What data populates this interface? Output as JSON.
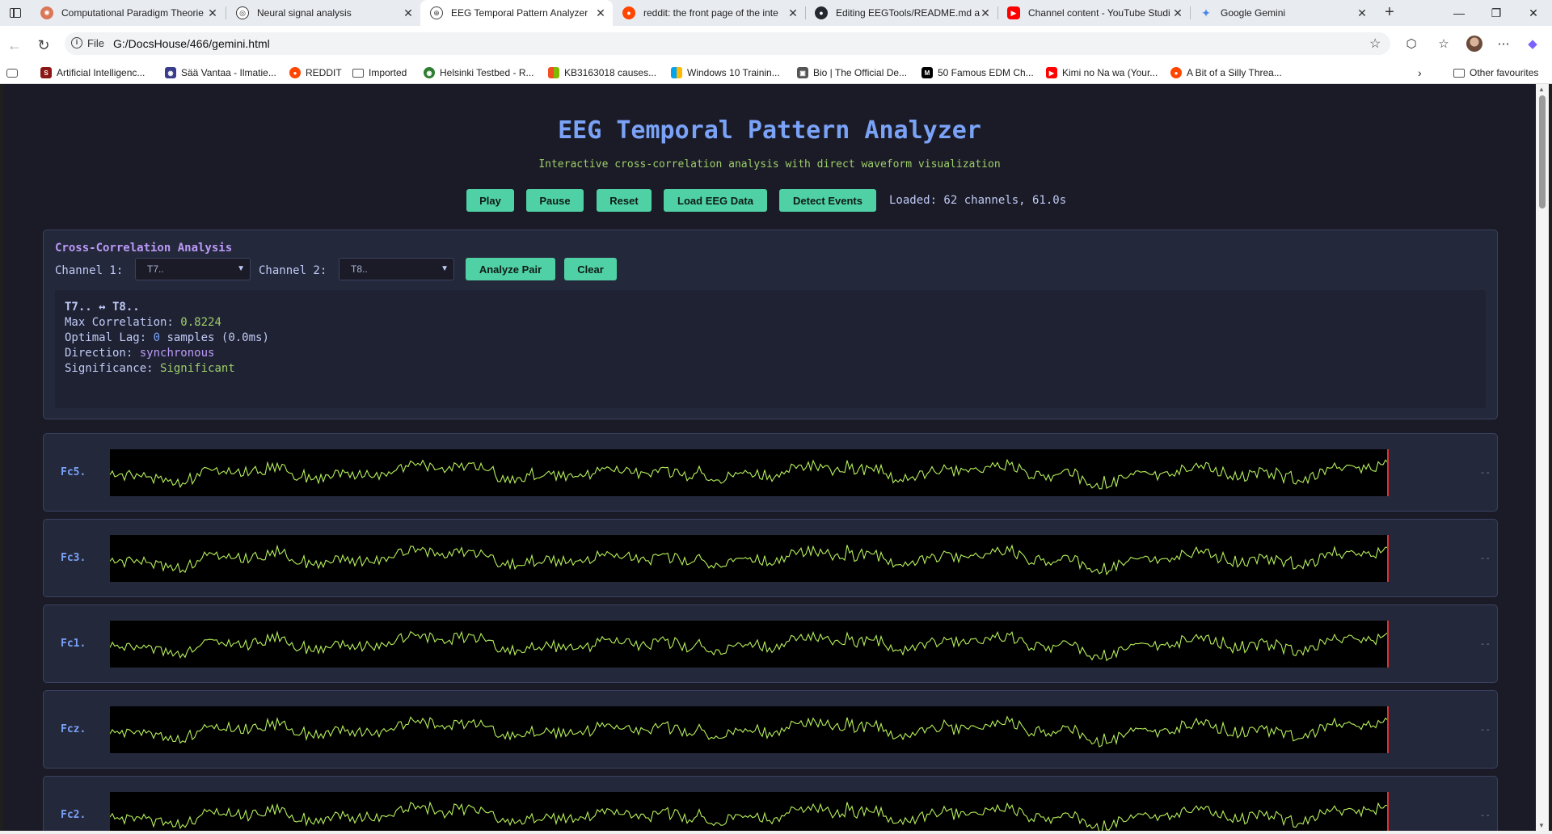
{
  "browser": {
    "tabs": [
      {
        "title": "Computational Paradigm Theorie",
        "icon": "claude-icon",
        "active": false
      },
      {
        "title": "Neural signal analysis",
        "icon": "chatgpt-icon",
        "active": false
      },
      {
        "title": "EEG Temporal Pattern Analyzer",
        "icon": "globe-icon",
        "active": true
      },
      {
        "title": "reddit: the front page of the inte",
        "icon": "reddit-icon",
        "active": false
      },
      {
        "title": "Editing EEGTools/README.md at",
        "icon": "github-icon",
        "active": false
      },
      {
        "title": "Channel content - YouTube Studi",
        "icon": "youtube-icon",
        "active": false
      },
      {
        "title": "Google Gemini",
        "icon": "gemini-icon",
        "active": false
      }
    ],
    "address": {
      "scheme_label": "File",
      "url": "G:/DocsHouse/466/gemini.html"
    },
    "bookmarks": [
      {
        "label": "Artificial Intelligenc...",
        "icon": "stanford-icon"
      },
      {
        "label": "Sää Vantaa - Ilmatie...",
        "icon": "fmi-icon"
      },
      {
        "label": "REDDIT",
        "icon": "reddit-icon"
      },
      {
        "label": "Imported",
        "icon": "folder-icon"
      },
      {
        "label": "Helsinki Testbed - R...",
        "icon": "globe-icon"
      },
      {
        "label": "KB3163018 causes...",
        "icon": "microsoft-icon"
      },
      {
        "label": "Windows 10 Trainin...",
        "icon": "microsoft-icon"
      },
      {
        "label": "Bio | The Official De...",
        "icon": "site-icon"
      },
      {
        "label": "50 Famous EDM Ch...",
        "icon": "medium-icon"
      },
      {
        "label": "Kimi no Na wa (Your...",
        "icon": "youtube-icon"
      },
      {
        "label": "A Bit of a Silly Threa...",
        "icon": "reddit-icon"
      }
    ],
    "other_favourites": "Other favourites"
  },
  "app": {
    "title": "EEG Temporal Pattern Analyzer",
    "subtitle": "Interactive cross-correlation analysis with direct waveform visualization",
    "controls": {
      "play": "Play",
      "pause": "Pause",
      "reset": "Reset",
      "load": "Load EEG Data",
      "detect": "Detect Events"
    },
    "loaded_status": "Loaded: 62 channels, 61.0s",
    "xcorr": {
      "title": "Cross-Correlation Analysis",
      "channel1_label": "Channel 1:",
      "channel1_value": "T7..",
      "channel2_label": "Channel 2:",
      "channel2_value": "T8..",
      "analyze": "Analyze Pair",
      "clear": "Clear",
      "result": {
        "pair": "T7.. ↔ T8..",
        "max_corr_label": "Max Correlation:",
        "max_corr_value": "0.8224",
        "lag_label": "Optimal Lag:",
        "lag_value": "0",
        "lag_unit": "samples (0.0ms)",
        "direction_label": "Direction:",
        "direction_value": "synchronous",
        "significance_label": "Significance:",
        "significance_value": "Significant"
      }
    },
    "channels": [
      {
        "name": "Fc5.",
        "metric": "--"
      },
      {
        "name": "Fc3.",
        "metric": "--"
      },
      {
        "name": "Fc1.",
        "metric": "--"
      },
      {
        "name": "Fcz.",
        "metric": "--"
      },
      {
        "name": "Fc2.",
        "metric": "--"
      }
    ],
    "colors": {
      "background": "#1a1b26",
      "title": "#7aa2f7",
      "subtitle": "#9ece6a",
      "button": "#4fd1a5",
      "waveform": "#b6f05a",
      "cursor": "#e03030",
      "panel": "#24283b",
      "section_title": "#bb9af7"
    }
  }
}
